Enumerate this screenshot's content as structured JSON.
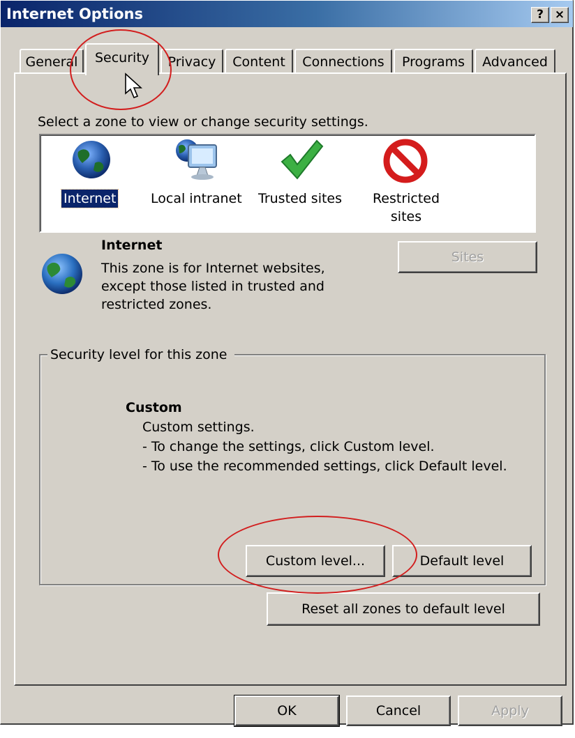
{
  "window": {
    "title": "Internet Options",
    "help_button": "?",
    "close_button": "×"
  },
  "tabs": [
    {
      "label": "General",
      "active": false
    },
    {
      "label": "Security",
      "active": true
    },
    {
      "label": "Privacy",
      "active": false
    },
    {
      "label": "Content",
      "active": false
    },
    {
      "label": "Connections",
      "active": false
    },
    {
      "label": "Programs",
      "active": false
    },
    {
      "label": "Advanced",
      "active": false
    }
  ],
  "security": {
    "instruction": "Select a zone to view or change security settings.",
    "zones": [
      {
        "label": "Internet",
        "icon": "globe-icon",
        "selected": true
      },
      {
        "label": "Local intranet",
        "icon": "intranet-icon",
        "selected": false
      },
      {
        "label": "Trusted sites",
        "icon": "checkmark-icon",
        "selected": false
      },
      {
        "label_line1": "Restricted",
        "label_line2": "sites",
        "icon": "prohibited-icon",
        "selected": false
      }
    ],
    "zone_info": {
      "title": "Internet",
      "line1": "This zone is for Internet websites,",
      "line2": "except those listed in trusted and",
      "line3": "restricted zones."
    },
    "sites_button": "Sites",
    "level_group": {
      "title": "Security level for this zone",
      "level_name": "Custom",
      "line1": "Custom settings.",
      "line2": "- To change the settings, click Custom level.",
      "line3": "- To use the recommended settings, click Default level."
    },
    "custom_level_button": "Custom level...",
    "default_level_button": "Default level",
    "reset_button": "Reset all zones to default level"
  },
  "footer": {
    "ok": "OK",
    "cancel": "Cancel",
    "apply": "Apply"
  },
  "colors": {
    "title_bar": "#0a246a",
    "selection": "#0a246a",
    "annotation": "#d21e1e",
    "dialog_face": "#d4d0c8"
  }
}
